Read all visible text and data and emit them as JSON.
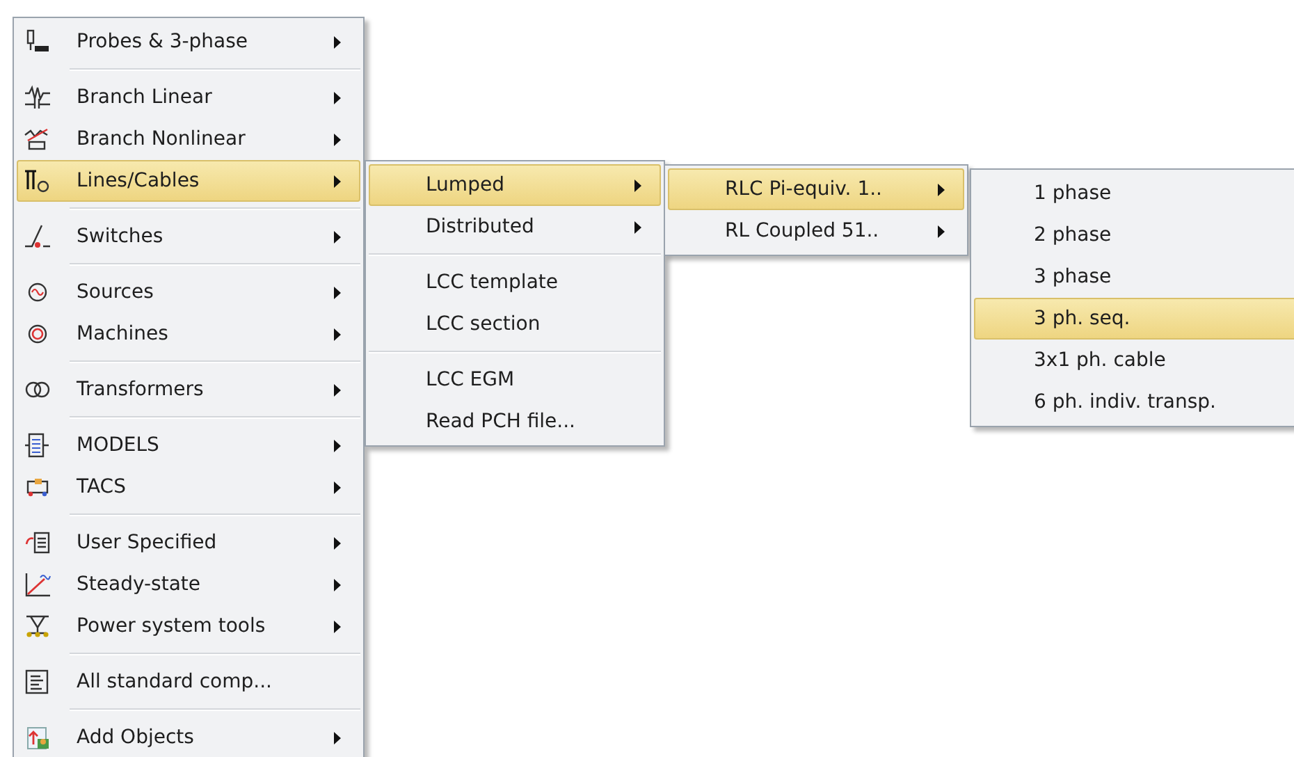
{
  "menu": {
    "items": [
      {
        "kind": "item",
        "label": "Probes & 3-phase",
        "submenu": true,
        "selected": false
      },
      {
        "kind": "separator"
      },
      {
        "kind": "item",
        "label": "Branch Linear",
        "submenu": true,
        "selected": false
      },
      {
        "kind": "item",
        "label": "Branch Nonlinear",
        "submenu": true,
        "selected": false
      },
      {
        "kind": "item",
        "label": "Lines/Cables",
        "submenu": true,
        "selected": true
      },
      {
        "kind": "separator"
      },
      {
        "kind": "item",
        "label": "Switches",
        "submenu": true,
        "selected": false
      },
      {
        "kind": "separator"
      },
      {
        "kind": "item",
        "label": "Sources",
        "submenu": true,
        "selected": false
      },
      {
        "kind": "item",
        "label": "Machines",
        "submenu": true,
        "selected": false
      },
      {
        "kind": "separator"
      },
      {
        "kind": "item",
        "label": "Transformers",
        "submenu": true,
        "selected": false
      },
      {
        "kind": "separator"
      },
      {
        "kind": "item",
        "label": "MODELS",
        "submenu": true,
        "selected": false
      },
      {
        "kind": "item",
        "label": "TACS",
        "submenu": true,
        "selected": false
      },
      {
        "kind": "separator"
      },
      {
        "kind": "item",
        "label": "User Specified",
        "submenu": true,
        "selected": false
      },
      {
        "kind": "item",
        "label": "Steady-state",
        "submenu": true,
        "selected": false
      },
      {
        "kind": "item",
        "label": "Power system tools",
        "submenu": true,
        "selected": false
      },
      {
        "kind": "separator"
      },
      {
        "kind": "item",
        "label": "All standard comp...",
        "submenu": false,
        "selected": false
      },
      {
        "kind": "separator"
      },
      {
        "kind": "item",
        "label": "Add Objects",
        "submenu": true,
        "selected": false
      }
    ]
  },
  "submenus": [
    {
      "items": [
        {
          "kind": "item",
          "label": "Lumped",
          "submenu": true,
          "selected": true
        },
        {
          "kind": "item",
          "label": "Distributed",
          "submenu": true,
          "selected": false
        },
        {
          "kind": "separator"
        },
        {
          "kind": "item",
          "label": "LCC template",
          "submenu": false,
          "selected": false
        },
        {
          "kind": "item",
          "label": "LCC section",
          "submenu": false,
          "selected": false
        },
        {
          "kind": "separator"
        },
        {
          "kind": "item",
          "label": "LCC EGM",
          "submenu": false,
          "selected": false
        },
        {
          "kind": "item",
          "label": "Read PCH file...",
          "submenu": false,
          "selected": false
        }
      ]
    },
    {
      "items": [
        {
          "kind": "item",
          "label": "RLC Pi-equiv. 1..",
          "submenu": true,
          "selected": true
        },
        {
          "kind": "item",
          "label": "RL Coupled 51..",
          "submenu": true,
          "selected": false
        }
      ]
    },
    {
      "items": [
        {
          "kind": "item",
          "label": "1 phase",
          "submenu": false,
          "selected": false
        },
        {
          "kind": "item",
          "label": "2 phase",
          "submenu": false,
          "selected": false
        },
        {
          "kind": "item",
          "label": "3 phase",
          "submenu": false,
          "selected": false
        },
        {
          "kind": "item",
          "label": "3 ph. seq.",
          "submenu": false,
          "selected": true
        },
        {
          "kind": "item",
          "label": "3x1 ph. cable",
          "submenu": false,
          "selected": false
        },
        {
          "kind": "item",
          "label": "6 ph. indiv. transp.",
          "submenu": false,
          "selected": false
        }
      ]
    }
  ]
}
